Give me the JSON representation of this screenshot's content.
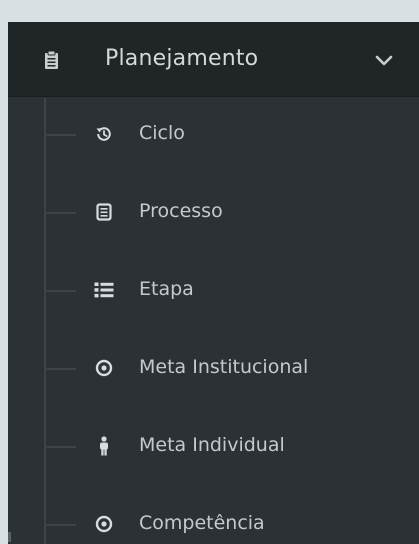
{
  "menu": {
    "header": {
      "label": "Planejamento",
      "icon": "clipboard-icon",
      "chevron": "chevron-down-icon"
    },
    "items": [
      {
        "label": "Ciclo",
        "icon": "history-icon"
      },
      {
        "label": "Processo",
        "icon": "document-icon"
      },
      {
        "label": "Etapa",
        "icon": "list-icon"
      },
      {
        "label": "Meta Institucional",
        "icon": "target-icon"
      },
      {
        "label": "Meta Individual",
        "icon": "person-icon"
      },
      {
        "label": "Competência",
        "icon": "target-icon"
      }
    ]
  },
  "colors": {
    "background": "#d9e0e3",
    "panel": "#2b3134",
    "header": "#202628",
    "text": "#c3c9cc",
    "icon": "#d8dcde",
    "tree_line": "#3d4447"
  }
}
